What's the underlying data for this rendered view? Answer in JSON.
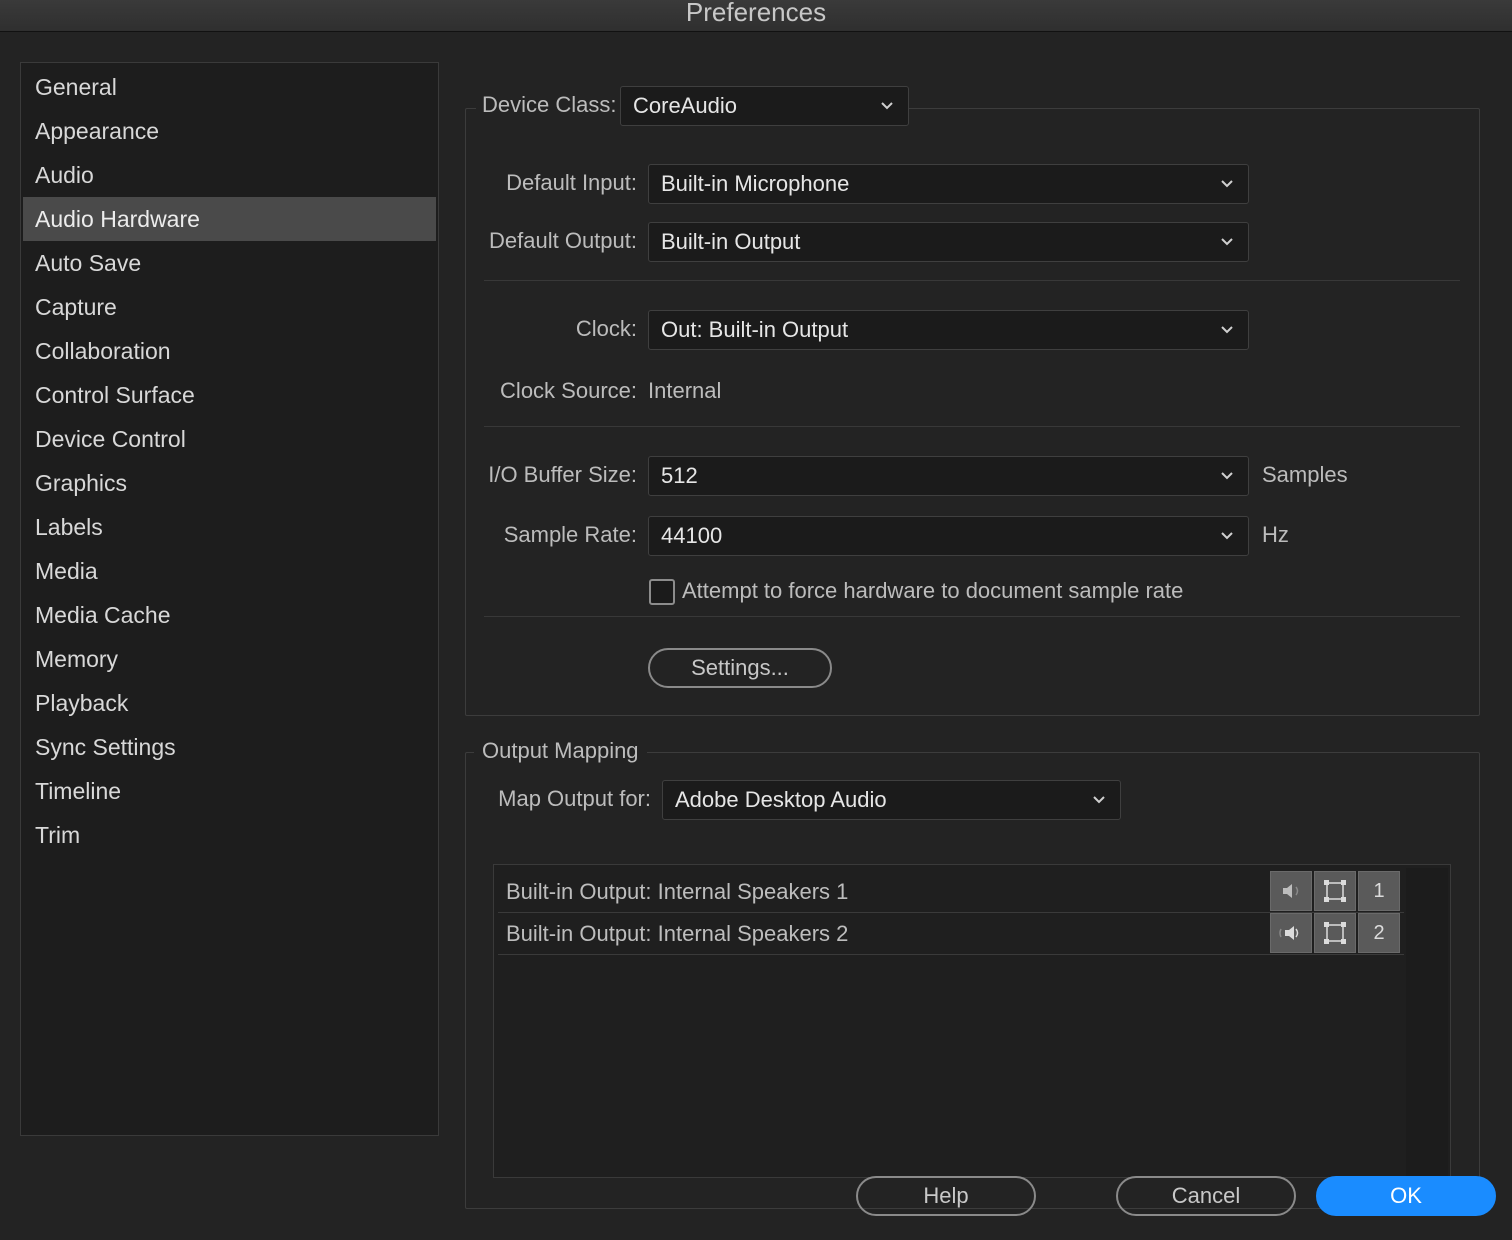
{
  "window": {
    "title": "Preferences"
  },
  "sidebar": {
    "items": [
      {
        "label": "General",
        "selected": false
      },
      {
        "label": "Appearance",
        "selected": false
      },
      {
        "label": "Audio",
        "selected": false
      },
      {
        "label": "Audio Hardware",
        "selected": true
      },
      {
        "label": "Auto Save",
        "selected": false
      },
      {
        "label": "Capture",
        "selected": false
      },
      {
        "label": "Collaboration",
        "selected": false
      },
      {
        "label": "Control Surface",
        "selected": false
      },
      {
        "label": "Device Control",
        "selected": false
      },
      {
        "label": "Graphics",
        "selected": false
      },
      {
        "label": "Labels",
        "selected": false
      },
      {
        "label": "Media",
        "selected": false
      },
      {
        "label": "Media Cache",
        "selected": false
      },
      {
        "label": "Memory",
        "selected": false
      },
      {
        "label": "Playback",
        "selected": false
      },
      {
        "label": "Sync Settings",
        "selected": false
      },
      {
        "label": "Timeline",
        "selected": false
      },
      {
        "label": "Trim",
        "selected": false
      }
    ]
  },
  "device": {
    "class_label": "Device Class:",
    "class_value": "CoreAudio",
    "default_input_label": "Default Input:",
    "default_input_value": "Built-in Microphone",
    "default_output_label": "Default Output:",
    "default_output_value": "Built-in Output",
    "clock_label": "Clock:",
    "clock_value": "Out: Built-in Output",
    "clock_source_label": "Clock Source:",
    "clock_source_value": "Internal",
    "buffer_label": "I/O Buffer Size:",
    "buffer_value": "512",
    "buffer_unit": "Samples",
    "sample_rate_label": "Sample Rate:",
    "sample_rate_value": "44100",
    "sample_rate_unit": "Hz",
    "force_rate_label": "Attempt to force hardware to document sample rate",
    "force_rate_checked": false,
    "settings_button": "Settings..."
  },
  "output_mapping": {
    "legend": "Output Mapping",
    "map_for_label": "Map Output for:",
    "map_for_value": "Adobe Desktop Audio",
    "rows": [
      {
        "label": "Built-in Output: Internal Speakers 1",
        "channel": "1"
      },
      {
        "label": "Built-in Output: Internal Speakers 2",
        "channel": "2"
      }
    ]
  },
  "footer": {
    "help": "Help",
    "cancel": "Cancel",
    "ok": "OK"
  },
  "colors": {
    "background": "#232323",
    "selected_item": "#4a4a4a",
    "accent": "#1a8cff"
  }
}
